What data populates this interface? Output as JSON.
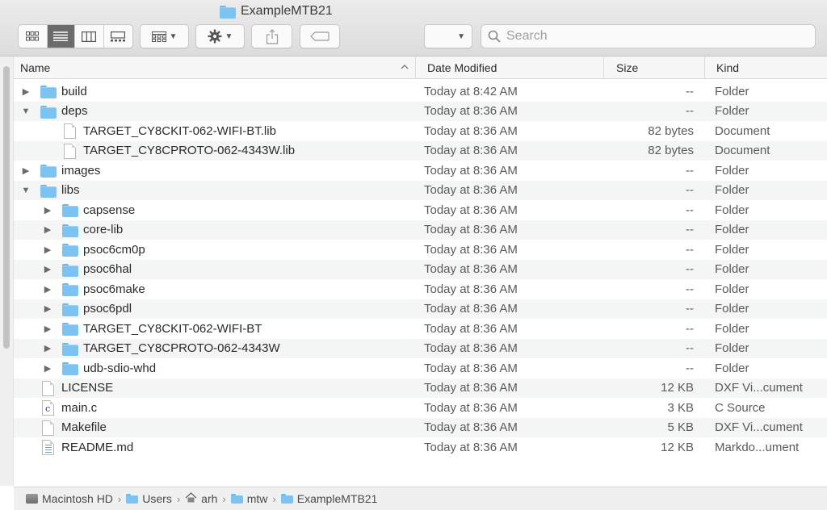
{
  "window": {
    "title": "ExampleMTB21"
  },
  "toolbar": {
    "search_placeholder": "Search",
    "view_modes": [
      "icon-view",
      "list-view",
      "column-view",
      "gallery-view"
    ],
    "active_view": "list-view"
  },
  "columns": {
    "name": "Name",
    "date": "Date Modified",
    "size": "Size",
    "kind": "Kind"
  },
  "rows": [
    {
      "name": "build",
      "date": "Today at 8:42 AM",
      "size": "--",
      "kind": "Folder",
      "type": "folder",
      "depth": 0,
      "disclosure": "collapsed"
    },
    {
      "name": "deps",
      "date": "Today at 8:36 AM",
      "size": "--",
      "kind": "Folder",
      "type": "folder",
      "depth": 0,
      "disclosure": "expanded"
    },
    {
      "name": "TARGET_CY8CKIT-062-WIFI-BT.lib",
      "date": "Today at 8:36 AM",
      "size": "82 bytes",
      "kind": "Document",
      "type": "doc",
      "depth": 1,
      "disclosure": "none"
    },
    {
      "name": "TARGET_CY8CPROTO-062-4343W.lib",
      "date": "Today at 8:36 AM",
      "size": "82 bytes",
      "kind": "Document",
      "type": "doc",
      "depth": 1,
      "disclosure": "none"
    },
    {
      "name": "images",
      "date": "Today at 8:36 AM",
      "size": "--",
      "kind": "Folder",
      "type": "folder",
      "depth": 0,
      "disclosure": "collapsed"
    },
    {
      "name": "libs",
      "date": "Today at 8:36 AM",
      "size": "--",
      "kind": "Folder",
      "type": "folder",
      "depth": 0,
      "disclosure": "expanded"
    },
    {
      "name": "capsense",
      "date": "Today at 8:36 AM",
      "size": "--",
      "kind": "Folder",
      "type": "folder",
      "depth": 1,
      "disclosure": "collapsed"
    },
    {
      "name": "core-lib",
      "date": "Today at 8:36 AM",
      "size": "--",
      "kind": "Folder",
      "type": "folder",
      "depth": 1,
      "disclosure": "collapsed"
    },
    {
      "name": "psoc6cm0p",
      "date": "Today at 8:36 AM",
      "size": "--",
      "kind": "Folder",
      "type": "folder",
      "depth": 1,
      "disclosure": "collapsed"
    },
    {
      "name": "psoc6hal",
      "date": "Today at 8:36 AM",
      "size": "--",
      "kind": "Folder",
      "type": "folder",
      "depth": 1,
      "disclosure": "collapsed"
    },
    {
      "name": "psoc6make",
      "date": "Today at 8:36 AM",
      "size": "--",
      "kind": "Folder",
      "type": "folder",
      "depth": 1,
      "disclosure": "collapsed"
    },
    {
      "name": "psoc6pdl",
      "date": "Today at 8:36 AM",
      "size": "--",
      "kind": "Folder",
      "type": "folder",
      "depth": 1,
      "disclosure": "collapsed"
    },
    {
      "name": "TARGET_CY8CKIT-062-WIFI-BT",
      "date": "Today at 8:36 AM",
      "size": "--",
      "kind": "Folder",
      "type": "folder",
      "depth": 1,
      "disclosure": "collapsed"
    },
    {
      "name": "TARGET_CY8CPROTO-062-4343W",
      "date": "Today at 8:36 AM",
      "size": "--",
      "kind": "Folder",
      "type": "folder",
      "depth": 1,
      "disclosure": "collapsed"
    },
    {
      "name": "udb-sdio-whd",
      "date": "Today at 8:36 AM",
      "size": "--",
      "kind": "Folder",
      "type": "folder",
      "depth": 1,
      "disclosure": "collapsed"
    },
    {
      "name": "LICENSE",
      "date": "Today at 8:36 AM",
      "size": "12 KB",
      "kind": "DXF Vi...cument",
      "type": "doc",
      "depth": 0,
      "disclosure": "none"
    },
    {
      "name": "main.c",
      "date": "Today at 8:36 AM",
      "size": "3 KB",
      "kind": "C Source",
      "type": "csource",
      "depth": 0,
      "disclosure": "none"
    },
    {
      "name": "Makefile",
      "date": "Today at 8:36 AM",
      "size": "5 KB",
      "kind": "DXF Vi...cument",
      "type": "doc",
      "depth": 0,
      "disclosure": "none"
    },
    {
      "name": "README.md",
      "date": "Today at 8:36 AM",
      "size": "12 KB",
      "kind": "Markdo...ument",
      "type": "textdoc",
      "depth": 0,
      "disclosure": "none"
    }
  ],
  "pathbar": [
    {
      "label": "Macintosh HD",
      "icon": "hard-drive-icon"
    },
    {
      "label": "Users",
      "icon": "users-folder-icon"
    },
    {
      "label": "arh",
      "icon": "home-icon"
    },
    {
      "label": "mtw",
      "icon": "folder-icon"
    },
    {
      "label": "ExampleMTB21",
      "icon": "folder-icon"
    }
  ],
  "colors": {
    "folder": "#7cc3f2",
    "row_alt": "#f4f5f5",
    "active_segment": "#6b6b6b"
  }
}
